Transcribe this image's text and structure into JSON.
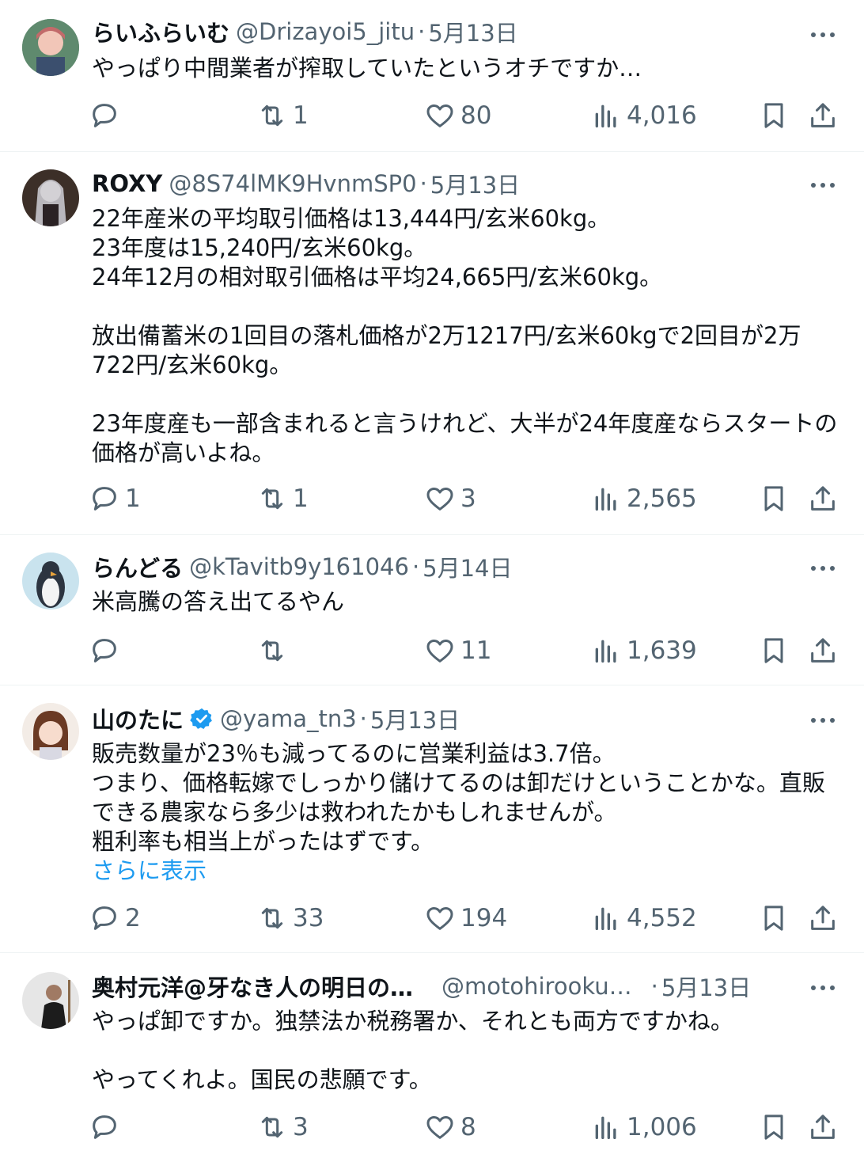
{
  "colors": {
    "text": "#0f1419",
    "muted": "#536471",
    "link": "#1d9bf0",
    "divider": "#eff3f4"
  },
  "tweets": [
    {
      "name": "らいふらいむ",
      "handle": "@Drizayoi5_jitu",
      "date": "5月13日",
      "verified": false,
      "text": "やっぱり中間業者が搾取していたというオチですか…",
      "show_more": "",
      "reply": "",
      "retweet": "1",
      "like": "80",
      "views": "4,016"
    },
    {
      "name": "ROXY",
      "handle": "@8S74lMK9HvnmSP0",
      "date": "5月13日",
      "verified": false,
      "text": "22年産米の平均取引価格は13,444円/玄米60kg。\n23年度は15,240円/玄米60kg。\n24年12月の相対取引価格は平均24,665円/玄米60kg。\n\n放出備蓄米の1回目の落札価格が2万1217円/玄米60kgで2回目が2万722円/玄米60kg。\n\n23年度産も一部含まれると言うけれど、大半が24年度産ならスタートの価格が高いよね。",
      "show_more": "",
      "reply": "1",
      "retweet": "1",
      "like": "3",
      "views": "2,565"
    },
    {
      "name": "らんどる",
      "handle": "@kTavitb9y161046",
      "date": "5月14日",
      "verified": false,
      "text": "米高騰の答え出てるやん",
      "show_more": "",
      "reply": "",
      "retweet": "",
      "like": "11",
      "views": "1,639"
    },
    {
      "name": "山のたに",
      "handle": "@yama_tn3",
      "date": "5月13日",
      "verified": true,
      "text": "販売数量が23％も減ってるのに営業利益は3.7倍。\nつまり、価格転嫁でしっかり儲けてるのは卸だけということかな。直販できる農家なら多少は救われたかもしれませんが。\n粗利率も相当上がったはずです。",
      "show_more": "さらに表示",
      "reply": "2",
      "retweet": "33",
      "like": "194",
      "views": "4,552"
    },
    {
      "name": "奥村元洋@牙なき人の明日の…",
      "handle": "@motohirooku…",
      "date": "5月13日",
      "verified": false,
      "text": "やっぱ卸ですか。独禁法か税務署か、それとも両方ですかね。\n\nやってくれよ。国民の悲願です。",
      "show_more": "",
      "reply": "",
      "retweet": "3",
      "like": "8",
      "views": "1,006"
    }
  ]
}
